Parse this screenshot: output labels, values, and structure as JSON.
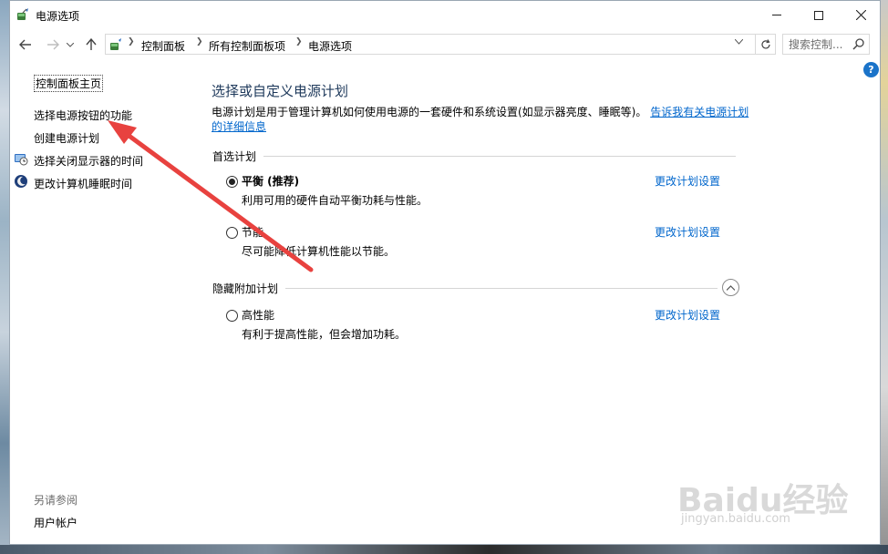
{
  "window": {
    "title": "电源选项",
    "controls": [
      "minimize",
      "maximize",
      "close"
    ]
  },
  "nav": {
    "breadcrumbs": [
      "控制面板",
      "所有控制面板项",
      "电源选项"
    ],
    "search_placeholder": "搜索控制..."
  },
  "sidebar": {
    "home": "控制面板主页",
    "links": [
      {
        "label": "选择电源按钮的功能",
        "icon": ""
      },
      {
        "label": "创建电源计划",
        "icon": ""
      },
      {
        "label": "选择关闭显示器的时间",
        "icon": "monitor-clock-icon"
      },
      {
        "label": "更改计算机睡眠时间",
        "icon": "sleep-moon-icon"
      }
    ],
    "see_also": "另请参阅",
    "see_also_links": [
      "用户帐户"
    ]
  },
  "main": {
    "title": "选择或自定义电源计划",
    "description": "电源计划是用于管理计算机如何使用电源的一套硬件和系统设置(如显示器亮度、睡眠等)。",
    "description_link": "告诉我有关电源计划的详细信息",
    "preferred_header": "首选计划",
    "hidden_header": "隐藏附加计划",
    "plans": [
      {
        "name": "平衡 (推荐)",
        "description": "利用可用的硬件自动平衡功耗与性能。",
        "selected": true,
        "link": "更改计划设置"
      },
      {
        "name": "节能",
        "description": "尽可能降低计算机性能以节能。",
        "selected": false,
        "link": "更改计划设置"
      },
      {
        "name": "高性能",
        "description": "有利于提高性能，但会增加功耗。",
        "selected": false,
        "link": "更改计划设置"
      }
    ]
  },
  "watermark": {
    "brand": "Baidu经验",
    "url": "jingyan.baidu.com"
  },
  "colors": {
    "link": "#0066cc",
    "title": "#1e395b",
    "annotation_arrow": "#e8423f"
  }
}
